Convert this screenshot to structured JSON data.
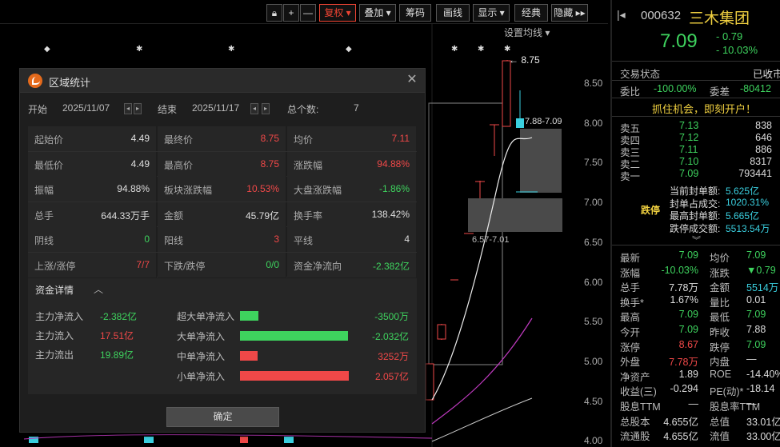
{
  "toolbar": {
    "buttons": [
      "+",
      "—",
      "复权",
      "叠加",
      "筹码",
      "画线",
      "显示",
      "经典",
      "隐藏"
    ],
    "settings_ma": "设置均线"
  },
  "axis": {
    "labels": [
      "8.50",
      "8.00",
      "7.50",
      "7.00",
      "6.50",
      "6.00",
      "5.50",
      "5.00",
      "4.50",
      "4.00"
    ]
  },
  "chart_annotations": {
    "high_label": "8.75",
    "range_label_1": "7.88-7.09",
    "range_label_2": "6.57-7.01"
  },
  "dialog": {
    "title": "区域统计",
    "start_label": "开始",
    "start_date": "2025/11/07",
    "end_label": "结束",
    "end_date": "2025/11/17",
    "count_label": "总个数:",
    "count_value": "7",
    "stats": [
      [
        {
          "label": "起始价",
          "value": "4.49",
          "color": ""
        },
        {
          "label": "最终价",
          "value": "8.75",
          "color": "red"
        },
        {
          "label": "均价",
          "value": "7.11",
          "color": "red"
        }
      ],
      [
        {
          "label": "最低价",
          "value": "4.49",
          "color": ""
        },
        {
          "label": "最高价",
          "value": "8.75",
          "color": "red"
        },
        {
          "label": "涨跌幅",
          "value": "94.88%",
          "color": "red"
        }
      ],
      [
        {
          "label": "振幅",
          "value": "94.88%",
          "color": ""
        },
        {
          "label": "板块涨跌幅",
          "value": "10.53%",
          "color": "red"
        },
        {
          "label": "大盘涨跌幅",
          "value": "-1.86%",
          "color": "green"
        }
      ],
      [
        {
          "label": "总手",
          "value": "644.33万手",
          "color": ""
        },
        {
          "label": "金额",
          "value": "45.79亿",
          "color": ""
        },
        {
          "label": "换手率",
          "value": "138.42%",
          "color": ""
        }
      ],
      [
        {
          "label": "阴线",
          "value": "0",
          "color": "green"
        },
        {
          "label": "阳线",
          "value": "3",
          "color": "red"
        },
        {
          "label": "平线",
          "value": "4",
          "color": ""
        }
      ],
      [
        {
          "label": "上涨/涨停",
          "value": "7/7",
          "color": "red"
        },
        {
          "label": "下跌/跌停",
          "value": "0/0",
          "color": "green"
        },
        {
          "label": "资金净流向",
          "value": "-2.382亿",
          "color": "green"
        }
      ]
    ],
    "funds": {
      "title": "资金详情",
      "left": [
        {
          "label": "主力净流入",
          "value": "-2.382亿",
          "color": "green"
        },
        {
          "label": "主力流入",
          "value": "17.51亿",
          "color": "red"
        },
        {
          "label": "主力流出",
          "value": "19.89亿",
          "color": "green"
        }
      ],
      "right": [
        {
          "label": "超大单净流入",
          "value": "-3500万",
          "color": "green",
          "fraction": 0.17
        },
        {
          "label": "大单净流入",
          "value": "-2.032亿",
          "color": "green",
          "fraction": 0.99
        },
        {
          "label": "中单净流入",
          "value": "3252万",
          "color": "red",
          "fraction": 0.16
        },
        {
          "label": "小单净流入",
          "value": "2.057亿",
          "color": "red",
          "fraction": 1.0
        }
      ]
    },
    "ok_label": "确定"
  },
  "quote": {
    "code": "000632",
    "name": "三木集团",
    "price": "7.09",
    "change": "- 0.79",
    "change_pct": "- 10.03%",
    "status_label": "交易状态",
    "status_value": "已收市",
    "weibi_label": "委比",
    "weibi_value": "-100.00%",
    "weicha_label": "委差",
    "weicha_value": "-80412",
    "promo": "抓住机会，即刻开户！",
    "asks": [
      {
        "label": "卖五",
        "price": "7.13",
        "vol": "838"
      },
      {
        "label": "卖四",
        "price": "7.12",
        "vol": "646"
      },
      {
        "label": "卖三",
        "price": "7.11",
        "vol": "886"
      },
      {
        "label": "卖二",
        "price": "7.10",
        "vol": "8317"
      },
      {
        "label": "卖一",
        "price": "7.09",
        "vol": "793441"
      }
    ],
    "limit_tag": "跌停",
    "limit_info": [
      {
        "label": "当前封单额:",
        "value": "5.625亿"
      },
      {
        "label": "封单占成交:",
        "value": "1020.31%"
      },
      {
        "label": "最高封单额:",
        "value": "5.665亿"
      },
      {
        "label": "跌停成交额:",
        "value": "5513.54万"
      }
    ],
    "detail_rows": [
      [
        {
          "label": "最新",
          "value": "7.09",
          "color": "green"
        },
        {
          "label": "均价",
          "value": "7.09",
          "color": "green"
        }
      ],
      [
        {
          "label": "涨幅",
          "value": "-10.03%",
          "color": "green"
        },
        {
          "label": "涨跌",
          "value": "▼0.79",
          "color": "green"
        }
      ],
      [
        {
          "label": "总手",
          "value": "7.78万",
          "color": ""
        },
        {
          "label": "金额",
          "value": "5514万",
          "color": "cyan"
        }
      ],
      [
        {
          "label": "换手*",
          "value": "1.67%",
          "color": ""
        },
        {
          "label": "量比",
          "value": "0.01",
          "color": ""
        }
      ],
      [
        {
          "label": "最高",
          "value": "7.09",
          "color": "green"
        },
        {
          "label": "最低",
          "value": "7.09",
          "color": "green"
        }
      ],
      [
        {
          "label": "今开",
          "value": "7.09",
          "color": "green"
        },
        {
          "label": "昨收",
          "value": "7.88",
          "color": ""
        }
      ],
      [
        {
          "label": "涨停",
          "value": "8.67",
          "color": "red"
        },
        {
          "label": "跌停",
          "value": "7.09",
          "color": "green"
        }
      ],
      [
        {
          "label": "外盘",
          "value": "7.78万",
          "color": "red"
        },
        {
          "label": "内盘",
          "value": "—",
          "color": ""
        }
      ],
      [
        {
          "label": "净资产",
          "value": "1.89",
          "color": ""
        },
        {
          "label": "ROE",
          "value": "-14.40%",
          "color": ""
        }
      ],
      [
        {
          "label": "收益(三)",
          "value": "-0.294",
          "color": ""
        },
        {
          "label": "PE(动)*",
          "value": "-18.14",
          "color": ""
        }
      ],
      [
        {
          "label": "股息TTM",
          "value": "—",
          "color": ""
        },
        {
          "label": "股息率TTM",
          "value": "—",
          "color": ""
        }
      ],
      [
        {
          "label": "总股本",
          "value": "4.655亿",
          "color": ""
        },
        {
          "label": "总值",
          "value": "33.01亿",
          "color": ""
        }
      ],
      [
        {
          "label": "流通股",
          "value": "4.655亿",
          "color": ""
        },
        {
          "label": "流值",
          "value": "33.00亿",
          "color": ""
        }
      ]
    ]
  },
  "colors": {
    "up": "#f04848",
    "down": "#3ed35e",
    "accent": "#e46a1c"
  }
}
